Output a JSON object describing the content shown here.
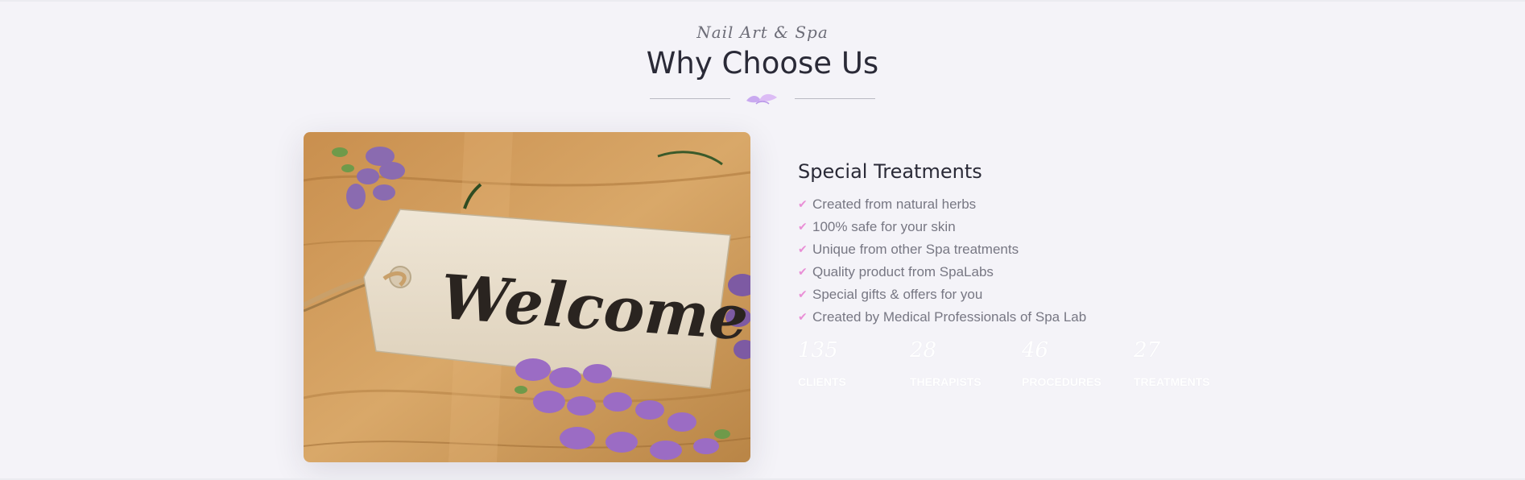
{
  "section": {
    "subtitle": "Nail Art & Spa",
    "title": "Why Choose Us"
  },
  "image": {
    "tag_text": "Welcome"
  },
  "treatments": {
    "title": "Special Treatments",
    "check_icon": "check-icon",
    "accent_color": "#e98fd6",
    "features": [
      "Created from natural herbs",
      "100% safe for your skin",
      "Unique from other Spa treatments",
      "Quality product from SpaLabs",
      "Special gifts & offers for you",
      "Created by Medical Professionals of Spa Lab"
    ]
  },
  "stats": [
    {
      "value": "135",
      "label": "CLIENTS"
    },
    {
      "value": "28",
      "label": "THERAPISTS"
    },
    {
      "value": "46",
      "label": "PROCEDURES"
    },
    {
      "value": "27",
      "label": "TREATMENTS"
    }
  ]
}
